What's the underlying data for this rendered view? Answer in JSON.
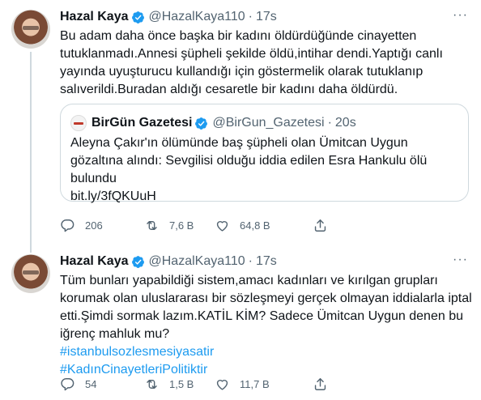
{
  "tweets": [
    {
      "display_name": "Hazal Kaya",
      "handle": "@HazalKaya110",
      "separator": "·",
      "time": "17s",
      "more": "···",
      "lines": [
        "Bu adam daha önce başka bir kadını öldürdüğünde cinayetten",
        "tutuklanmadı.Annesi şüpheli şekilde öldü,intihar dendi.Yaptığı canlı",
        "yayında uyuşturucu kullandığı için göstermelik olarak tutuklanıp",
        "salıverildi.Buradan aldığı cesaretle bir kadını daha öldürdü."
      ],
      "quote": {
        "display_name": "BirGün Gazetesi",
        "handle": "@BirGun_Gazetesi",
        "separator": "·",
        "time": "20s",
        "lines": [
          "Aleyna Çakır'ın ölümünde baş şüpheli olan Ümitcan Uygun",
          "gözaltına alındı: Sevgilisi olduğu iddia edilen Esra Hankulu ölü",
          "bulundu",
          "bit.ly/3fQKUuH"
        ]
      },
      "actions": {
        "replies": "206",
        "retweets": "7,6 B",
        "likes": "64,8 B"
      }
    },
    {
      "display_name": "Hazal Kaya",
      "handle": "@HazalKaya110",
      "separator": "·",
      "time": "17s",
      "more": "···",
      "lines": [
        "Tüm bunları yapabildiği sistem,amacı kadınları ve kırılgan grupları",
        "korumak olan uluslararası bir sözleşmeyi gerçek olmayan iddialarla iptal",
        "etti.Şimdi sormak lazım.KATİL KİM? Sadece Ümitcan Uygun denen bu",
        "iğrenç mahluk mu?"
      ],
      "hashtags": [
        "#istanbulsozlesmesiyasatir",
        "#KadınCinayetleriPolitiktir"
      ],
      "actions": {
        "replies": "54",
        "retweets": "1,5 B",
        "likes": "11,7 B"
      }
    }
  ],
  "icons": {
    "verified": "verified-badge-icon",
    "reply": "reply-icon",
    "retweet": "retweet-icon",
    "like": "heart-icon",
    "share": "share-icon"
  },
  "colors": {
    "accent": "#1d9bf0",
    "text": "#0f1419",
    "muted": "#536471",
    "border": "#cfd9de"
  }
}
